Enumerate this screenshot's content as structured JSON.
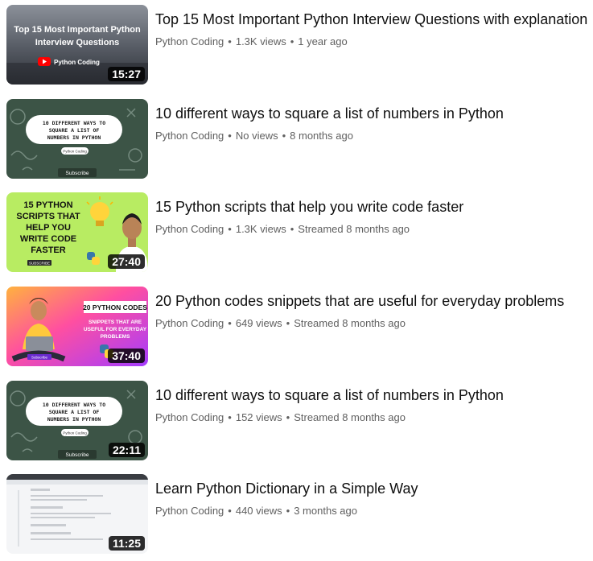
{
  "videos": [
    {
      "title": "Top 15 Most Important Python Interview Questions with explanation",
      "channel": "Python Coding",
      "views": "1.3K views",
      "age": "1 year ago",
      "duration": "15:27",
      "thumb_text": [
        "Top 15 Most Important Python",
        "Interview Questions"
      ],
      "thumb_brand": "Python Coding"
    },
    {
      "title": "10 different ways to square a list of numbers in Python",
      "channel": "Python Coding",
      "views": "No views",
      "age": "8 months ago",
      "duration": "",
      "thumb_text": [
        "10 DIFFERENT WAYS TO",
        "SQUARE A LIST OF",
        "NUMBERS IN PYTHON"
      ],
      "thumb_brand": "Python Coding",
      "thumb_button": "Subscribe"
    },
    {
      "title": "15 Python scripts that help you write code faster",
      "channel": "Python Coding",
      "views": "1.3K views",
      "age": "Streamed 8 months ago",
      "duration": "27:40",
      "thumb_text": [
        "15 PYTHON",
        "SCRIPTS THAT",
        "HELP YOU",
        "WRITE CODE",
        "FASTER"
      ],
      "thumb_button": "SUBSCRIBE"
    },
    {
      "title": "20 Python codes snippets that are useful for everyday problems",
      "channel": "Python Coding",
      "views": "649 views",
      "age": "Streamed 8 months ago",
      "duration": "37:40",
      "thumb_text": [
        "20 PYTHON CODES",
        "SNIPPETS THAT ARE",
        "USEFUL FOR EVERYDAY",
        "PROBLEMS"
      ],
      "thumb_button": "Subscribe"
    },
    {
      "title": "10 different ways to square a list of numbers in Python",
      "channel": "Python Coding",
      "views": "152 views",
      "age": "Streamed 8 months ago",
      "duration": "22:11",
      "thumb_text": [
        "10 DIFFERENT WAYS TO",
        "SQUARE A LIST OF",
        "NUMBERS IN PYTHON"
      ],
      "thumb_brand": "Python Coding",
      "thumb_button": "Subscribe"
    },
    {
      "title": "Learn Python Dictionary in a Simple Way",
      "channel": "Python Coding",
      "views": "440 views",
      "age": "3 months ago",
      "duration": "11:25",
      "thumb_text": []
    }
  ],
  "colors": {
    "title": "#0f0f0f",
    "meta": "#606060",
    "duration_bg": "#000000",
    "board_green": "#3c5446",
    "python_yellow": "#ffd43b",
    "python_blue": "#3776ab"
  }
}
